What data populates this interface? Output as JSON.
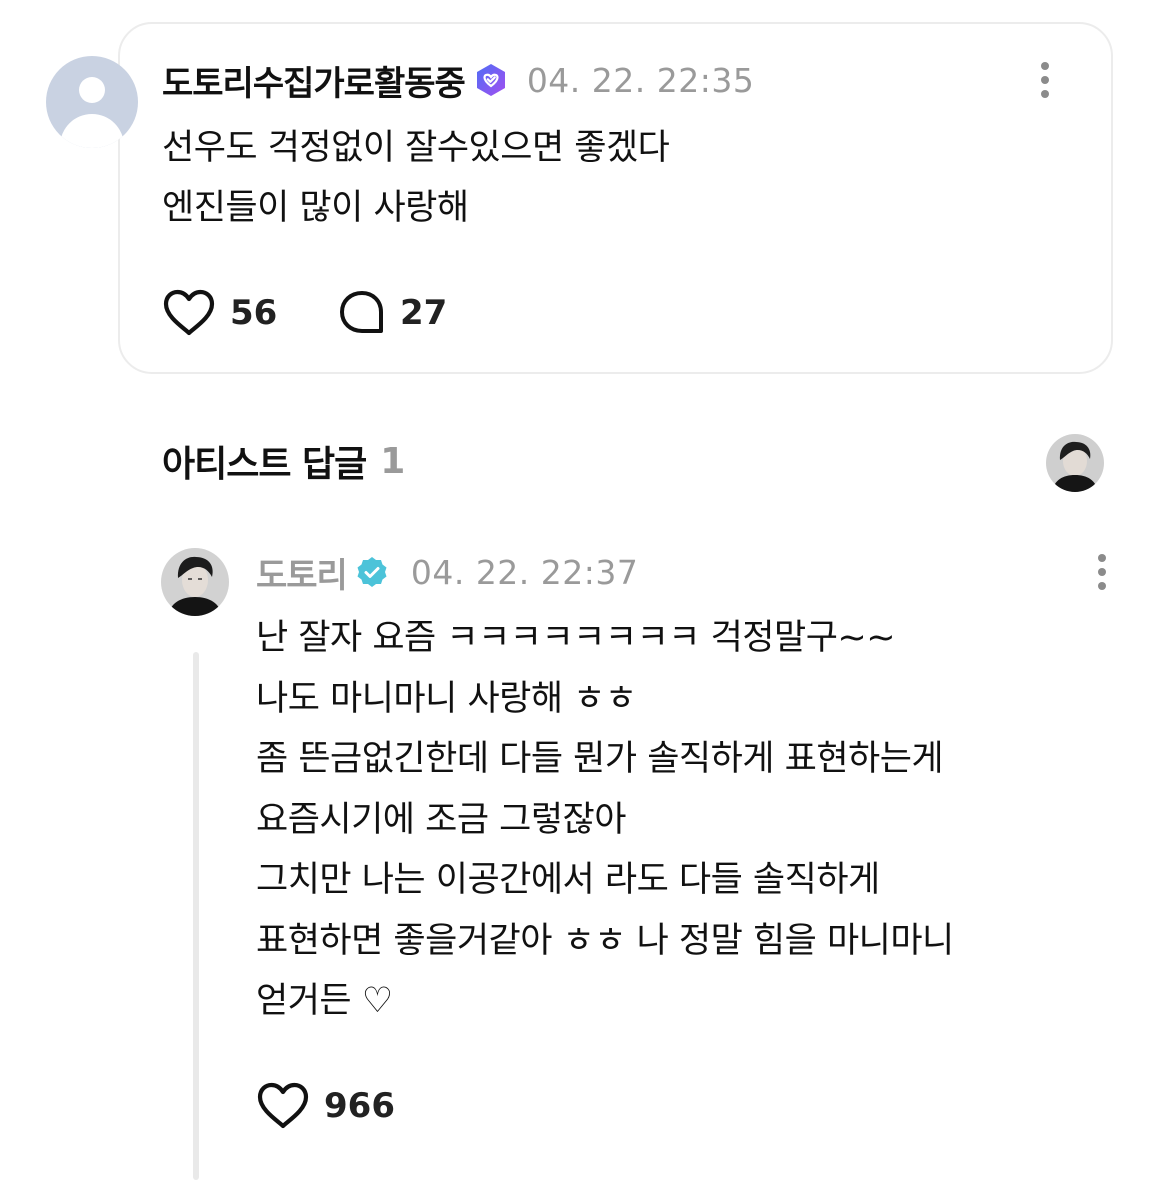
{
  "parent_comment": {
    "author": "도토리수집가로활동중",
    "timestamp": "04. 22. 22:35",
    "lines": [
      "선우도 걱정없이 잘수있으면 좋겠다",
      "엔진들이 많이 사랑해"
    ],
    "likes": "56",
    "replies": "27",
    "badge_color": "#7b5cf0"
  },
  "artist_replies": {
    "title": "아티스트 답글",
    "count": "1"
  },
  "reply": {
    "author": "도토리",
    "timestamp": "04. 22. 22:37",
    "lines": [
      "난 잘자 요즘 ㅋㅋㅋㅋㅋㅋㅋㅋ 걱정말구~~",
      "나도 마니마니 사랑해 ㅎㅎ",
      "좀 뜬금없긴한데 다들 뭔가 솔직하게 표현하는게",
      "요즘시기에 조금 그렇잖아",
      "그치만 나는 이공간에서 라도 다들 솔직하게",
      "표현하면 좋을거같아 ㅎㅎ 나 정말 힘을 마니마니",
      "얻거든 ♡"
    ],
    "likes": "966",
    "badge_color": "#4cc3d9"
  }
}
